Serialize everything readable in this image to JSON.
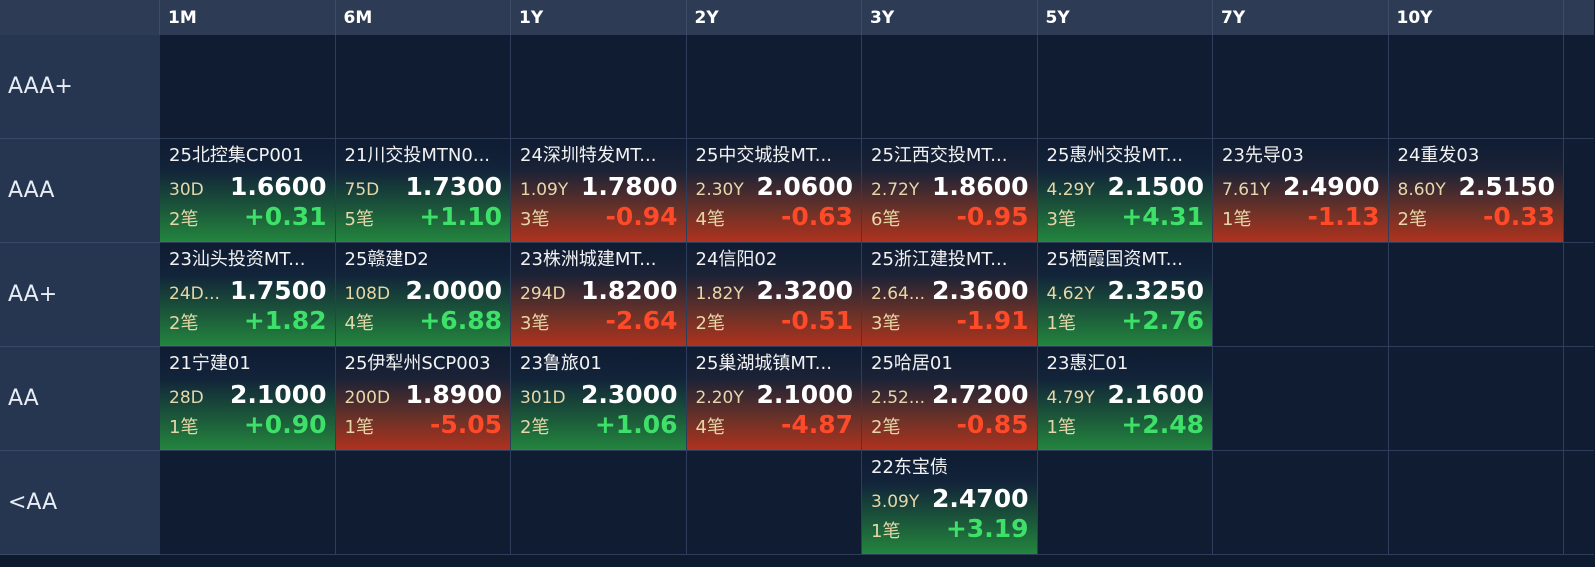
{
  "columns": [
    "1M",
    "6M",
    "1Y",
    "2Y",
    "3Y",
    "5Y",
    "7Y",
    "10Y"
  ],
  "rows": [
    "AAA+",
    "AAA",
    "AA+",
    "AA",
    "<AA"
  ],
  "colors": {
    "up": "#23863e",
    "down": "#b0321e",
    "pos_text": "#3ee06a",
    "neg_text": "#ff4a2a"
  },
  "cells": {
    "AAA": [
      {
        "col": 0,
        "name": "25北控集CP001",
        "term": "30D",
        "yield": "1.6600",
        "count": "2笔",
        "change": "+0.31",
        "dir": "up"
      },
      {
        "col": 1,
        "name": "21川交投MTN0...",
        "term": "75D",
        "yield": "1.7300",
        "count": "5笔",
        "change": "+1.10",
        "dir": "up"
      },
      {
        "col": 2,
        "name": "24深圳特发MT...",
        "term": "1.09Y",
        "yield": "1.7800",
        "count": "3笔",
        "change": "-0.94",
        "dir": "down"
      },
      {
        "col": 3,
        "name": "25中交城投MT...",
        "term": "2.30Y",
        "yield": "2.0600",
        "count": "4笔",
        "change": "-0.63",
        "dir": "down"
      },
      {
        "col": 4,
        "name": "25江西交投MT...",
        "term": "2.72Y",
        "yield": "1.8600",
        "count": "6笔",
        "change": "-0.95",
        "dir": "down"
      },
      {
        "col": 5,
        "name": "25惠州交投MT...",
        "term": "4.29Y",
        "yield": "2.1500",
        "count": "3笔",
        "change": "+4.31",
        "dir": "up"
      },
      {
        "col": 6,
        "name": "23先导03",
        "term": "7.61Y",
        "yield": "2.4900",
        "count": "1笔",
        "change": "-1.13",
        "dir": "down"
      },
      {
        "col": 7,
        "name": "24重发03",
        "term": "8.60Y",
        "yield": "2.5150",
        "count": "2笔",
        "change": "-0.33",
        "dir": "down"
      }
    ],
    "AA+": [
      {
        "col": 0,
        "name": "23汕头投资MT...",
        "term": "24D...",
        "yield": "1.7500",
        "count": "2笔",
        "change": "+1.82",
        "dir": "up"
      },
      {
        "col": 1,
        "name": "25赣建D2",
        "term": "108D",
        "yield": "2.0000",
        "count": "4笔",
        "change": "+6.88",
        "dir": "up"
      },
      {
        "col": 2,
        "name": "23株洲城建MT...",
        "term": "294D",
        "yield": "1.8200",
        "count": "3笔",
        "change": "-2.64",
        "dir": "down"
      },
      {
        "col": 3,
        "name": "24信阳02",
        "term": "1.82Y",
        "yield": "2.3200",
        "count": "2笔",
        "change": "-0.51",
        "dir": "down"
      },
      {
        "col": 4,
        "name": "25浙江建投MT...",
        "term": "2.64...",
        "yield": "2.3600",
        "count": "3笔",
        "change": "-1.91",
        "dir": "down"
      },
      {
        "col": 5,
        "name": "25栖霞国资MT...",
        "term": "4.62Y",
        "yield": "2.3250",
        "count": "1笔",
        "change": "+2.76",
        "dir": "up"
      }
    ],
    "AA": [
      {
        "col": 0,
        "name": "21宁建01",
        "term": "28D",
        "yield": "2.1000",
        "count": "1笔",
        "change": "+0.90",
        "dir": "up"
      },
      {
        "col": 1,
        "name": "25伊犁州SCP003",
        "term": "200D",
        "yield": "1.8900",
        "count": "1笔",
        "change": "-5.05",
        "dir": "down"
      },
      {
        "col": 2,
        "name": "23鲁旅01",
        "term": "301D",
        "yield": "2.3000",
        "count": "2笔",
        "change": "+1.06",
        "dir": "up"
      },
      {
        "col": 3,
        "name": "25巢湖城镇MT...",
        "term": "2.20Y",
        "yield": "2.1000",
        "count": "4笔",
        "change": "-4.87",
        "dir": "down"
      },
      {
        "col": 4,
        "name": "25哈居01",
        "term": "2.52...",
        "yield": "2.7200",
        "count": "2笔",
        "change": "-0.85",
        "dir": "down"
      },
      {
        "col": 5,
        "name": "23惠汇01",
        "term": "4.79Y",
        "yield": "2.1600",
        "count": "1笔",
        "change": "+2.48",
        "dir": "up"
      }
    ],
    "<AA": [
      {
        "col": 4,
        "name": "22东宝债",
        "term": "3.09Y",
        "yield": "2.4700",
        "count": "1笔",
        "change": "+3.19",
        "dir": "up"
      }
    ]
  }
}
